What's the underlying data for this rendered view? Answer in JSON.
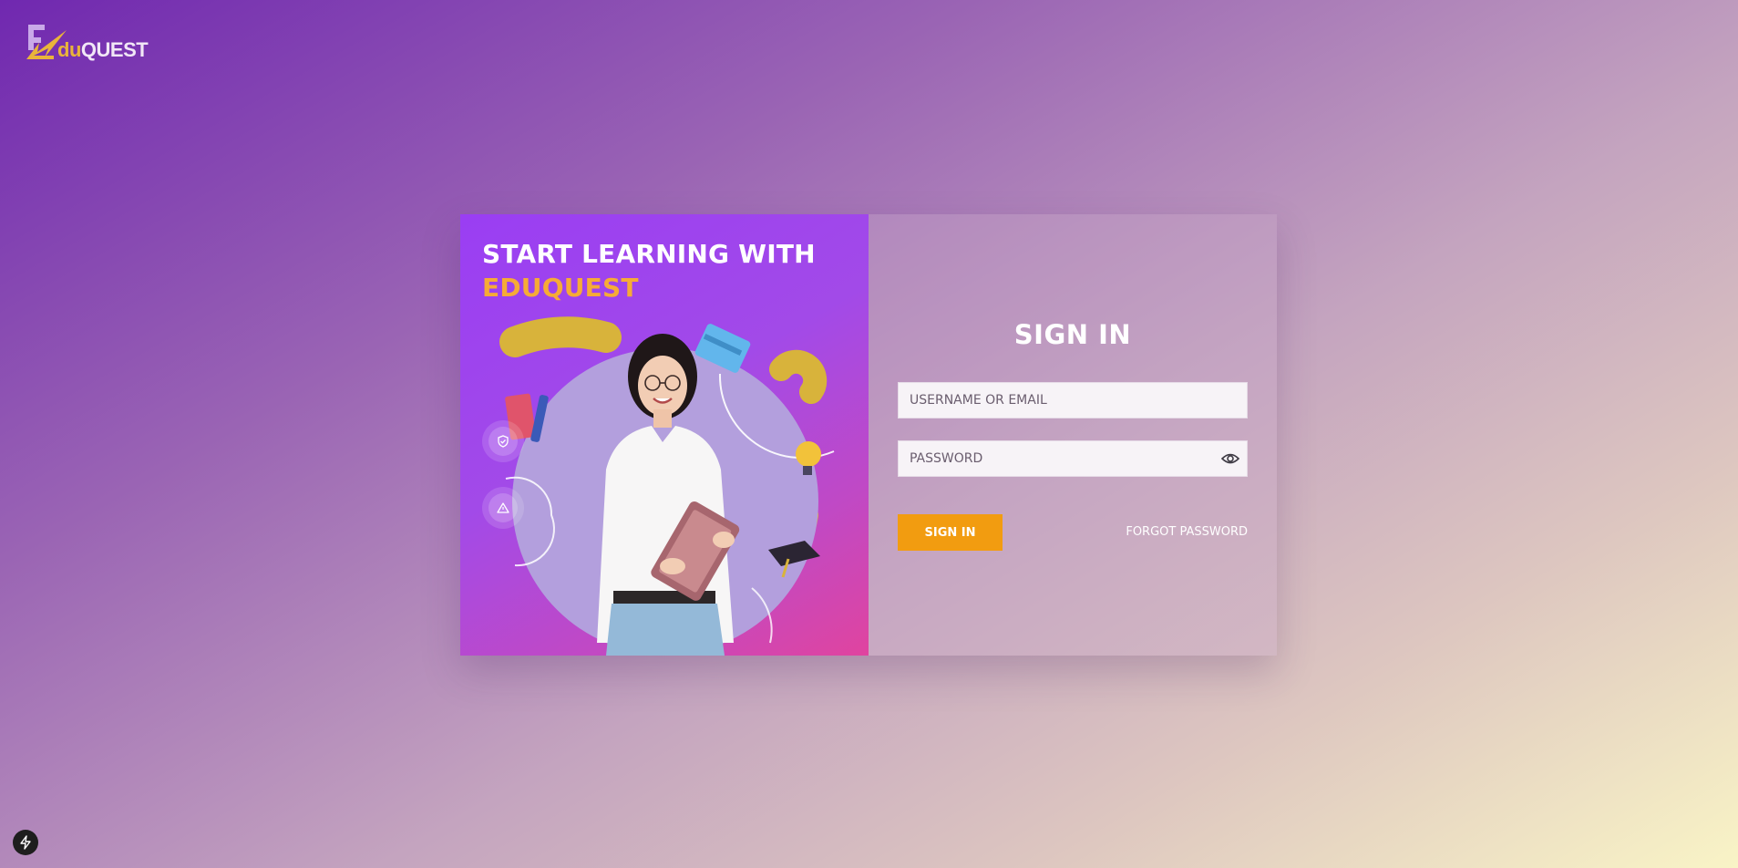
{
  "brand": {
    "logo_prefix": "du",
    "logo_suffix": "QUEST"
  },
  "hero": {
    "headline": "START LEARNING WITH",
    "headline_accent": "EDUQUEST"
  },
  "signin": {
    "title": "SIGN IN",
    "username_placeholder": "USERNAME OR EMAIL",
    "password_placeholder": "PASSWORD",
    "submit_label": "SIGN IN",
    "forgot_label": "FORGOT PASSWORD"
  },
  "icons": {
    "logo": "eduquest-logo-icon",
    "shield": "shield-check-icon",
    "warning": "warning-triangle-icon",
    "eye": "eye-icon",
    "bolt": "lightning-bolt-icon"
  },
  "colors": {
    "accent": "#f29c10",
    "headline_accent": "#f6ab36",
    "logo_du": "#e9b43a",
    "panel_gradient_start": "#9a3ef3",
    "panel_gradient_end": "#e0449f"
  }
}
